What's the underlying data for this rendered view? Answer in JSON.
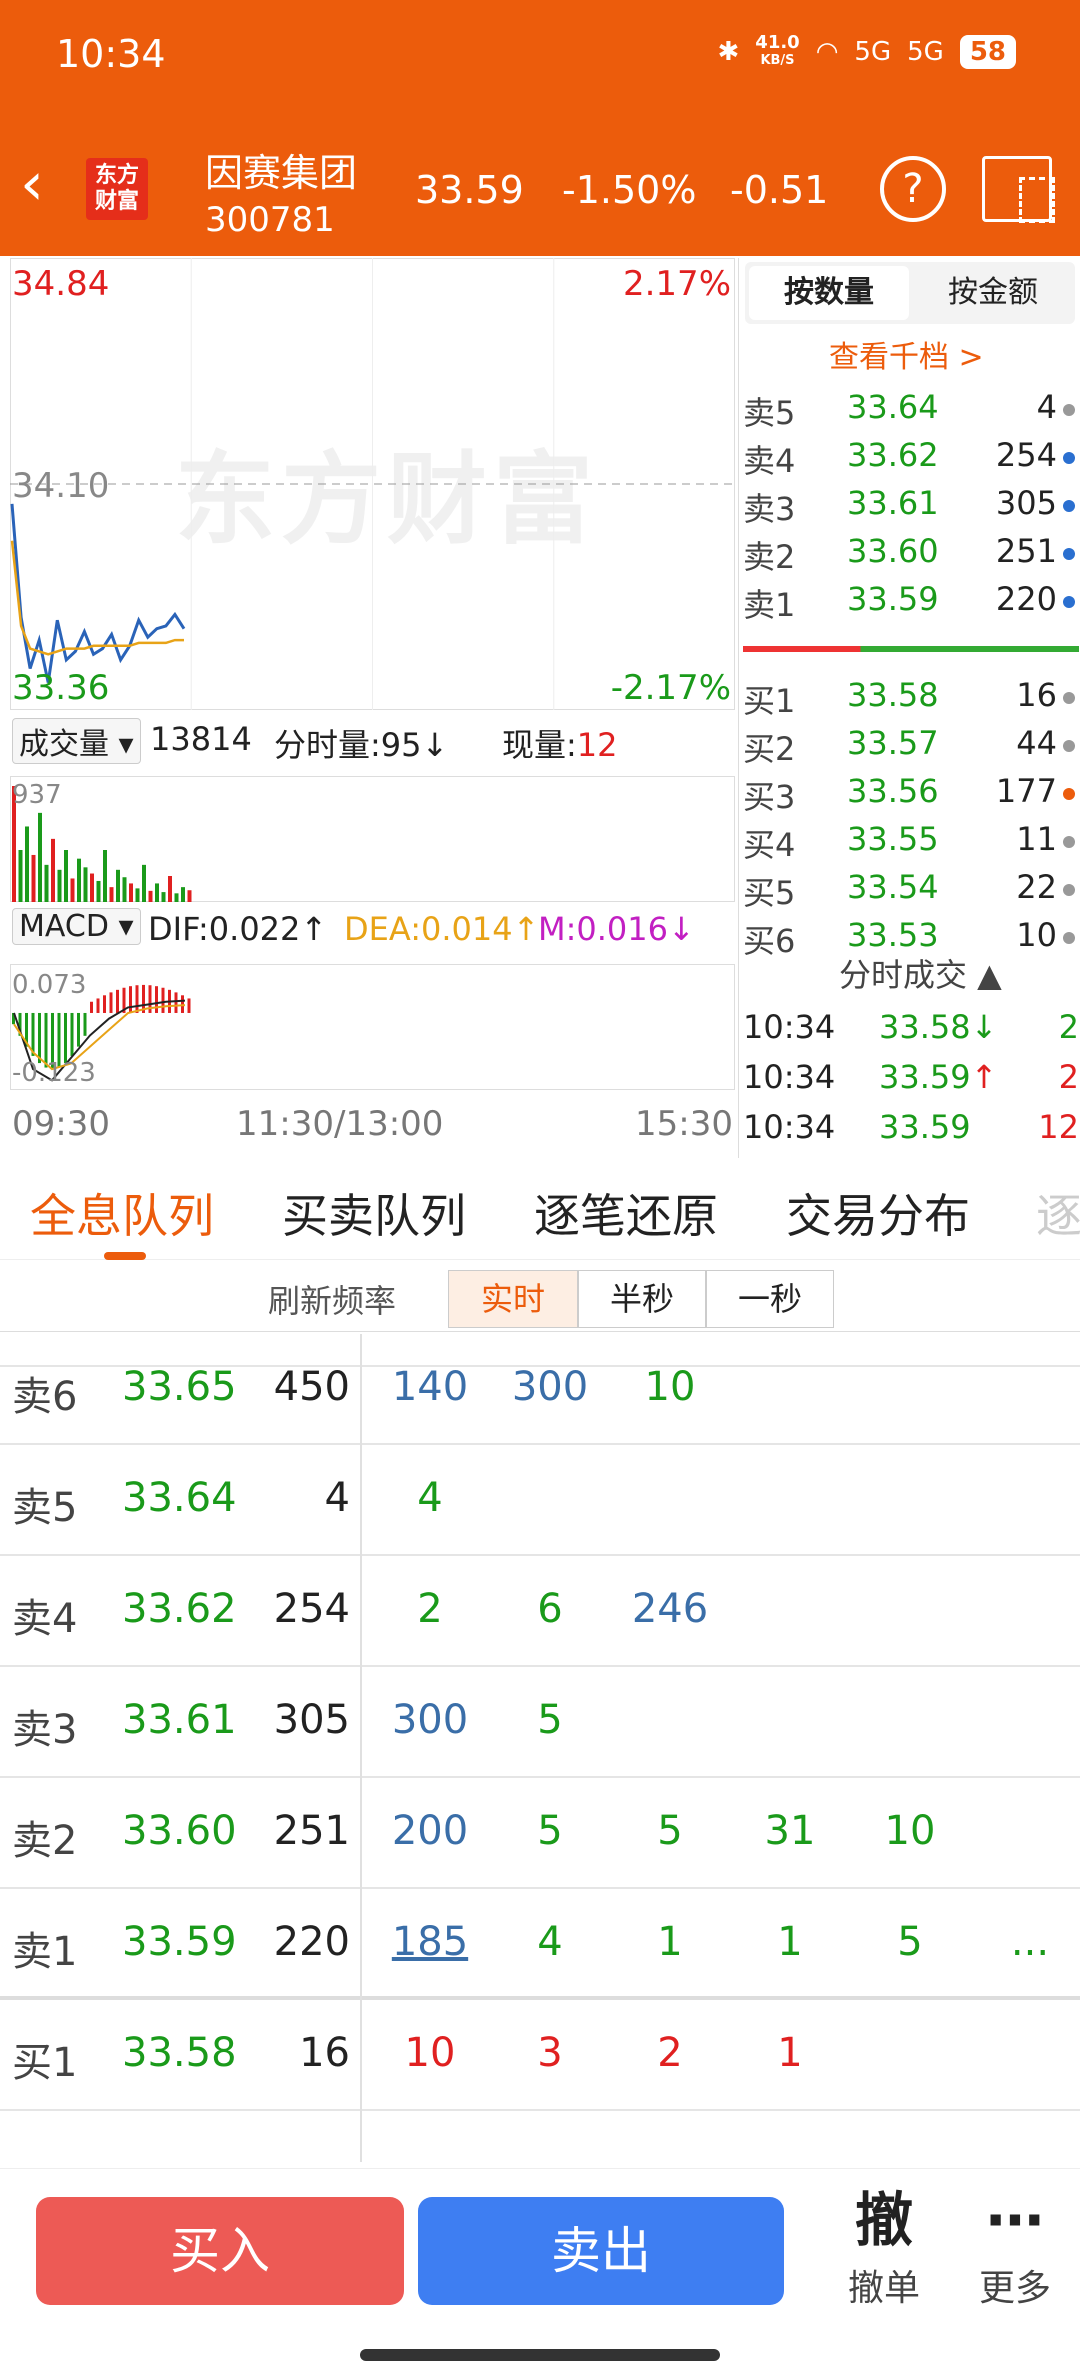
{
  "status_bar": {
    "time": "10:34",
    "net_speed_value": "41.0",
    "net_speed_unit": "KB/S",
    "signal1": "5G",
    "signal2": "5G",
    "battery": "58",
    "bluetooth_icon": "bluetooth-icon",
    "wifi_icon": "wifi-icon"
  },
  "header": {
    "logo_text": "东方财富",
    "stock_name": "因赛集团",
    "stock_code": "300781",
    "price": "33.59",
    "change_pct": "-1.50%",
    "change": "-0.51",
    "help_symbol": "?"
  },
  "intraday": {
    "high_price": "34.84",
    "high_pct": "2.17%",
    "ref_price": "34.10",
    "low_price": "33.36",
    "low_pct": "-2.17%",
    "watermark": "东方财富",
    "volume_dropdown": "成交量",
    "volume_total": "13814",
    "tick_volume": "分时量:95",
    "tick_volume_arrow": "↓",
    "current_label": "现量:",
    "current_value": "12",
    "volume_axis_label": "937",
    "macd_dropdown": "MACD",
    "dif": "DIF:0.022",
    "dif_arrow": "↑",
    "dea": "DEA:0.014",
    "dea_arrow": "↑",
    "m": "M:0.016",
    "m_arrow": "↓",
    "macd_top": "0.073",
    "macd_bottom": "-0.123",
    "time_start": "09:30",
    "time_mid": "11:30/13:00",
    "time_end": "15:30"
  },
  "chart_data": {
    "type": "line",
    "title": "",
    "ylim": [
      33.36,
      34.84
    ],
    "reference_line": 34.1,
    "series": [
      {
        "values": [
          34.03,
          33.63,
          33.45,
          33.55,
          33.4,
          33.62,
          33.48,
          33.51,
          33.58,
          33.5,
          33.52,
          33.57,
          33.48,
          33.53,
          33.62,
          33.56,
          33.59,
          33.6,
          33.64,
          33.59
        ]
      },
      {
        "values": [
          33.9,
          33.6,
          33.52,
          33.51,
          33.5,
          33.51,
          33.52,
          33.52,
          33.52,
          33.53,
          33.53,
          33.53,
          33.53,
          33.53,
          33.54,
          33.54,
          33.54,
          33.54,
          33.55,
          33.55
        ]
      }
    ],
    "volume": [
      937,
      420,
      610,
      380,
      720,
      300,
      510,
      260,
      420,
      190,
      350,
      280,
      230,
      170,
      420,
      120,
      260,
      200,
      150,
      110,
      300,
      90,
      150,
      80,
      210,
      70,
      120,
      95
    ],
    "macd_range": [
      -0.123,
      0.073
    ]
  },
  "orderbook": {
    "tab_qty": "按数量",
    "tab_amount": "按金额",
    "more_levels": "查看千档 >",
    "asks": [
      {
        "label": "卖5",
        "price": "33.64",
        "vol": "4",
        "dot": "#999999"
      },
      {
        "label": "卖4",
        "price": "33.62",
        "vol": "254",
        "dot": "#2a6fd0"
      },
      {
        "label": "卖3",
        "price": "33.61",
        "vol": "305",
        "dot": "#2a6fd0"
      },
      {
        "label": "卖2",
        "price": "33.60",
        "vol": "251",
        "dot": "#2a6fd0"
      },
      {
        "label": "卖1",
        "price": "33.59",
        "vol": "220",
        "dot": "#2a6fd0"
      }
    ],
    "bids": [
      {
        "label": "买1",
        "price": "33.58",
        "vol": "16",
        "dot": "#999999"
      },
      {
        "label": "买2",
        "price": "33.57",
        "vol": "44",
        "dot": "#999999"
      },
      {
        "label": "买3",
        "price": "33.56",
        "vol": "177",
        "dot": "#ec5c0c"
      },
      {
        "label": "买4",
        "price": "33.55",
        "vol": "11",
        "dot": "#999999"
      },
      {
        "label": "买5",
        "price": "33.54",
        "vol": "22",
        "dot": "#999999"
      },
      {
        "label": "买6",
        "price": "33.53",
        "vol": "10",
        "dot": "#999999"
      }
    ],
    "ticks_title": "分时成交 ▲",
    "ticks": [
      {
        "time": "10:34",
        "price": "33.58",
        "arrow": "↓",
        "vol": "2"
      },
      {
        "time": "10:34",
        "price": "33.59",
        "arrow": "↑",
        "vol": "2"
      },
      {
        "time": "10:34",
        "price": "33.59",
        "arrow": "",
        "vol": "12"
      }
    ]
  },
  "tabs": [
    "全息队列",
    "买卖队列",
    "逐笔还原",
    "交易分布",
    "逐"
  ],
  "refresh": {
    "label": "刷新频率",
    "options": [
      "实时",
      "半秒",
      "一秒"
    ]
  },
  "queue": [
    {
      "label": "卖6",
      "price": "33.65",
      "total": "450",
      "orders": [
        "140",
        "300",
        "10"
      ]
    },
    {
      "label": "卖5",
      "price": "33.64",
      "total": "4",
      "orders": [
        "4"
      ]
    },
    {
      "label": "卖4",
      "price": "33.62",
      "total": "254",
      "orders": [
        "2",
        "6",
        "246"
      ]
    },
    {
      "label": "卖3",
      "price": "33.61",
      "total": "305",
      "orders": [
        "300",
        "5"
      ]
    },
    {
      "label": "卖2",
      "price": "33.60",
      "total": "251",
      "orders": [
        "200",
        "5",
        "5",
        "31",
        "10"
      ]
    },
    {
      "label": "卖1",
      "price": "33.59",
      "total": "220",
      "orders": [
        "185",
        "4",
        "1",
        "1",
        "5",
        "..."
      ]
    },
    {
      "label": "买1",
      "price": "33.58",
      "total": "16",
      "orders": [
        "10",
        "3",
        "2",
        "1"
      ]
    }
  ],
  "bottom": {
    "buy": "买入",
    "sell": "卖出",
    "cancel_icon": "撤",
    "cancel": "撤单",
    "more_icon": "⋯",
    "more": "更多"
  }
}
